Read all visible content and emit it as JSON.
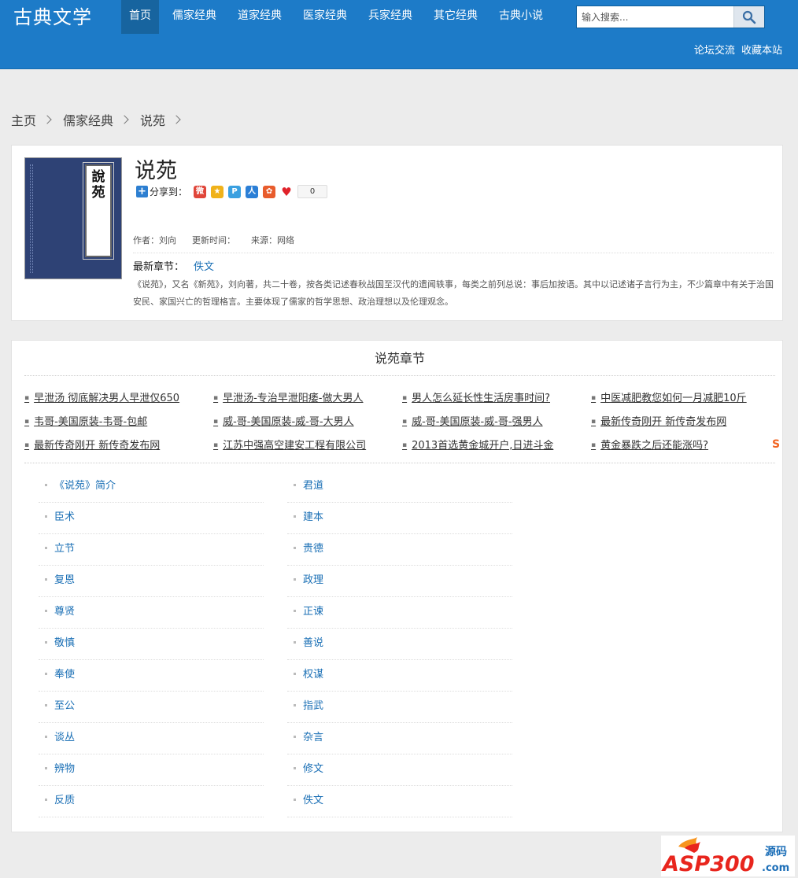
{
  "site": {
    "logo": "古典文学"
  },
  "nav": [
    "首页",
    "儒家经典",
    "道家经典",
    "医家经典",
    "兵家经典",
    "其它经典",
    "古典小说"
  ],
  "search": {
    "placeholder": "输入搜索..."
  },
  "toplinks": [
    "论坛交流",
    "收藏本站"
  ],
  "breadcrumb": [
    "主页",
    "儒家经典",
    "说苑"
  ],
  "book": {
    "cover_text": "說苑",
    "title": "说苑",
    "share_label": "分享到：",
    "share_count": "0",
    "author": "作者：刘向",
    "updated": "更新时间：",
    "source": "来源：网络",
    "latest_label": "最新章节：",
    "latest_chapter": "佚文",
    "intro": "《说苑》，又名《新苑》，刘向著，共二十卷，按各类记述春秋战国至汉代的遗闻轶事，每类之前列总说：事后加按语。其中以记述诸子言行为主，不少篇章中有关于治国安民、家国兴亡的哲理格言。主要体现了儒家的哲学思想、政治理想以及伦理观念。"
  },
  "chapters_title": "说苑章节",
  "ads": [
    "早泄汤 彻底解决男人早泄仅650",
    "早泄汤-专治早泄阳痿-做大男人",
    "男人怎么延长性生活房事时间?",
    "中医减肥教您如何一月减肥10斤",
    "韦哥-美国原装-韦哥-包邮",
    "威-哥-美国原装-威-哥-大男人",
    "威-哥-美国原装-威-哥-强男人",
    "最新传奇刚开 新传奇发布网",
    "最新传奇刚开 新传奇发布网",
    "江苏中强高空建安工程有限公司",
    "2013首选黄金城开户,日进斗金",
    "黄金暴跌之后还能涨吗?"
  ],
  "ads_logo": "S",
  "chapters_left": [
    "《说苑》简介",
    "臣术",
    "立节",
    "复恩",
    "尊贤",
    "敬慎",
    "奉使",
    "至公",
    "谈丛",
    "辨物",
    "反质"
  ],
  "chapters_right": [
    "君道",
    "建本",
    "贵德",
    "政理",
    "正谏",
    "善说",
    "权谋",
    "指武",
    "杂言",
    "修文",
    "佚文"
  ],
  "watermark": {
    "brand": "ASP300",
    "sub": "源码",
    "domain": ".com"
  }
}
